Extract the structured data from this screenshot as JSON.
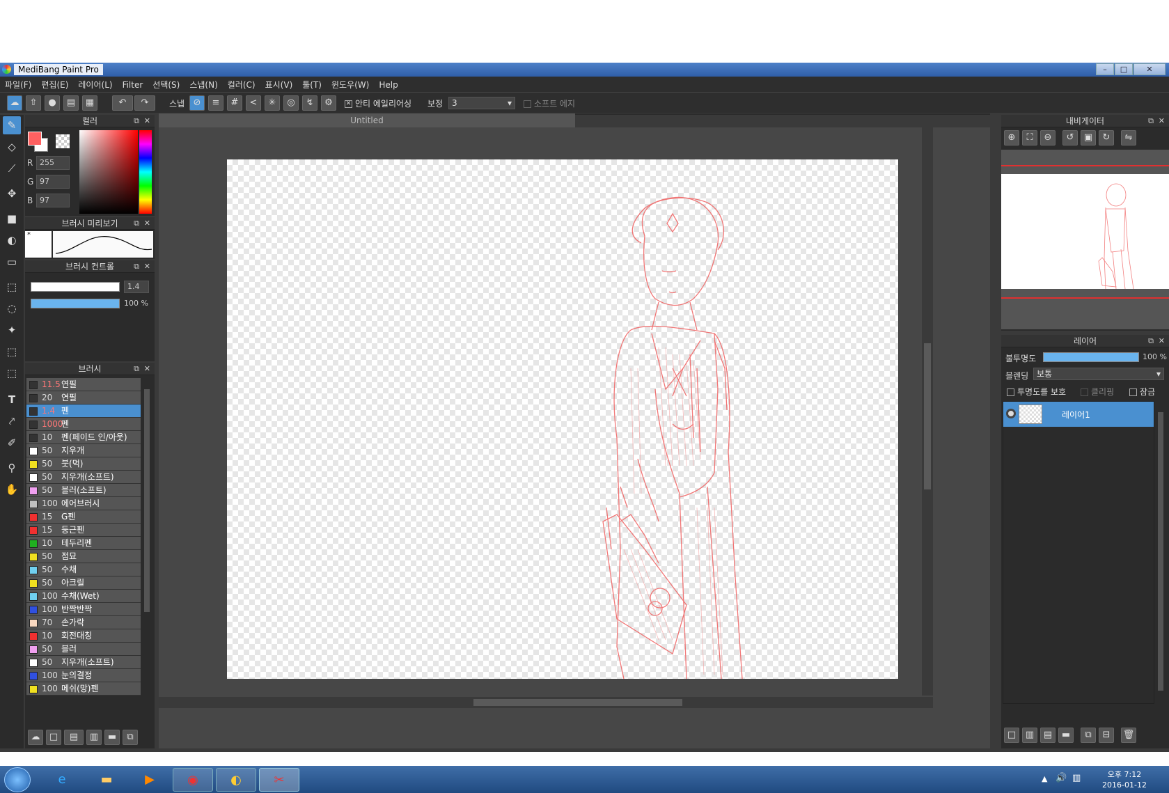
{
  "window": {
    "title": "MediBang Paint Pro"
  },
  "menu": [
    "파일(F)",
    "편집(E)",
    "레이어(L)",
    "Filter",
    "선택(S)",
    "스냅(N)",
    "컬러(C)",
    "표시(V)",
    "툴(T)",
    "윈도우(W)",
    "Help"
  ],
  "toolbar": {
    "snap_label": "스냅",
    "antialias_label": "안티 에일리어싱",
    "correction_label": "보정",
    "correction_value": "3",
    "soft_edge_label": "소프트 에지"
  },
  "color_panel": {
    "title": "컬러",
    "r_label": "R",
    "g_label": "G",
    "b_label": "B",
    "r": "255",
    "g": "97",
    "b": "97",
    "fg_color": "#ff6161"
  },
  "brush_preview": {
    "title": "브러시 미리보기",
    "marker": "*"
  },
  "brush_control": {
    "title": "브러시 컨트롤",
    "size": "1.4",
    "opacity": "100 %",
    "opacity_fraction": 1.0
  },
  "brush_panel": {
    "title": "브러시",
    "items": [
      {
        "size": "11.5",
        "name": "연필",
        "color": "#333333",
        "red": true
      },
      {
        "size": "20",
        "name": "연필",
        "color": "#333333",
        "red": false
      },
      {
        "size": "1.4",
        "name": "펜",
        "color": "#333333",
        "red": true,
        "selected": true
      },
      {
        "size": "1000",
        "name": "펜",
        "color": "#333333",
        "red": true
      },
      {
        "size": "10",
        "name": "펜(페이드 인/아웃)",
        "color": "#333333",
        "red": false
      },
      {
        "size": "50",
        "name": "지우개",
        "color": "#ffffff",
        "red": false
      },
      {
        "size": "50",
        "name": "붓(먹)",
        "color": "#f0e020",
        "red": false
      },
      {
        "size": "50",
        "name": "지우개(소프트)",
        "color": "#ffffff",
        "red": false
      },
      {
        "size": "50",
        "name": "블러(소프트)",
        "color": "#f0a0f0",
        "red": false
      },
      {
        "size": "100",
        "name": "에어브러시",
        "color": "#c0c0c0",
        "red": false
      },
      {
        "size": "15",
        "name": "G펜",
        "color": "#f03030",
        "red": false
      },
      {
        "size": "15",
        "name": "둥근펜",
        "color": "#f03030",
        "red": false
      },
      {
        "size": "10",
        "name": "테두리펜",
        "color": "#20b020",
        "red": false
      },
      {
        "size": "50",
        "name": "점묘",
        "color": "#f0e020",
        "red": false
      },
      {
        "size": "50",
        "name": "수채",
        "color": "#70d0f0",
        "red": false
      },
      {
        "size": "50",
        "name": "아크릴",
        "color": "#f0e020",
        "red": false
      },
      {
        "size": "100",
        "name": "수채(Wet)",
        "color": "#70d0f0",
        "red": false
      },
      {
        "size": "100",
        "name": "반짝반짝",
        "color": "#3050e0",
        "red": false
      },
      {
        "size": "70",
        "name": "손가락",
        "color": "#f8d8c0",
        "red": false
      },
      {
        "size": "10",
        "name": "회전대칭",
        "color": "#f03030",
        "red": false
      },
      {
        "size": "50",
        "name": "블러",
        "color": "#f0a0f0",
        "red": false
      },
      {
        "size": "50",
        "name": "지우개(소프트)",
        "color": "#ffffff",
        "red": false
      },
      {
        "size": "100",
        "name": "눈의결정",
        "color": "#3050e0",
        "red": false
      },
      {
        "size": "100",
        "name": "메쉬(망)펜",
        "color": "#f0e020",
        "red": false
      }
    ]
  },
  "canvas": {
    "tab_title": "Untitled"
  },
  "navigator": {
    "title": "내비게이터"
  },
  "layer_panel": {
    "title": "레이어",
    "opacity_label": "불투명도",
    "opacity_value": "100 %",
    "opacity_fraction": 1.0,
    "blend_label": "블렌딩",
    "blend_value": "보통",
    "protect_alpha": "투명도를 보호",
    "clipping": "클리핑",
    "lock": "잠금",
    "layer_name": "레이어1"
  },
  "taskbar": {
    "time": "오후 7:12",
    "date": "2016-01-12"
  }
}
